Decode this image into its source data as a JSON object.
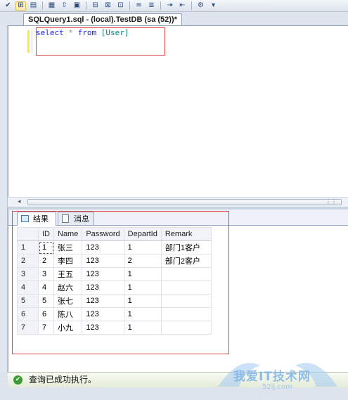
{
  "toolbar": {
    "icons": [
      "check-icon",
      "query-designer-icon",
      "results-to-text-icon",
      "results-to-grid-icon",
      "include-stats-icon",
      "results-to-file-icon",
      "indent-icon",
      "outdent-icon",
      "comment-icon",
      "uncomment-icon",
      "specify-values-icon"
    ]
  },
  "document_tab": {
    "title": "SQLQuery1.sql - (local).TestDB (sa (52))*"
  },
  "editor": {
    "keyword_select": "select",
    "star": "*",
    "keyword_from": "from",
    "object": "[User]"
  },
  "results": {
    "tabs": [
      {
        "label": "结果"
      },
      {
        "label": "消息"
      }
    ],
    "columns": [
      "ID",
      "Name",
      "Password",
      "DepartId",
      "Remark"
    ],
    "rows": [
      {
        "n": "1",
        "ID": "1",
        "Name": "张三",
        "Password": "123",
        "DepartId": "1",
        "Remark": "部门1客户"
      },
      {
        "n": "2",
        "ID": "2",
        "Name": "李四",
        "Password": "123",
        "DepartId": "2",
        "Remark": "部门2客户"
      },
      {
        "n": "3",
        "ID": "3",
        "Name": "王五",
        "Password": "123",
        "DepartId": "1",
        "Remark": ""
      },
      {
        "n": "4",
        "ID": "4",
        "Name": "赵六",
        "Password": "123",
        "DepartId": "1",
        "Remark": ""
      },
      {
        "n": "5",
        "ID": "5",
        "Name": "张七",
        "Password": "123",
        "DepartId": "1",
        "Remark": ""
      },
      {
        "n": "6",
        "ID": "6",
        "Name": "陈八",
        "Password": "123",
        "DepartId": "1",
        "Remark": ""
      },
      {
        "n": "7",
        "ID": "7",
        "Name": "小九",
        "Password": "123",
        "DepartId": "1",
        "Remark": ""
      }
    ]
  },
  "status": {
    "message": "查询已成功执行。"
  },
  "watermark": {
    "text": "我爱IT技术网",
    "url": "52ij.com"
  },
  "colors": {
    "keyword": "#1a1aff",
    "object": "#008080",
    "highlight_box": "#dd4444",
    "status_ok": "#3e9a33"
  }
}
